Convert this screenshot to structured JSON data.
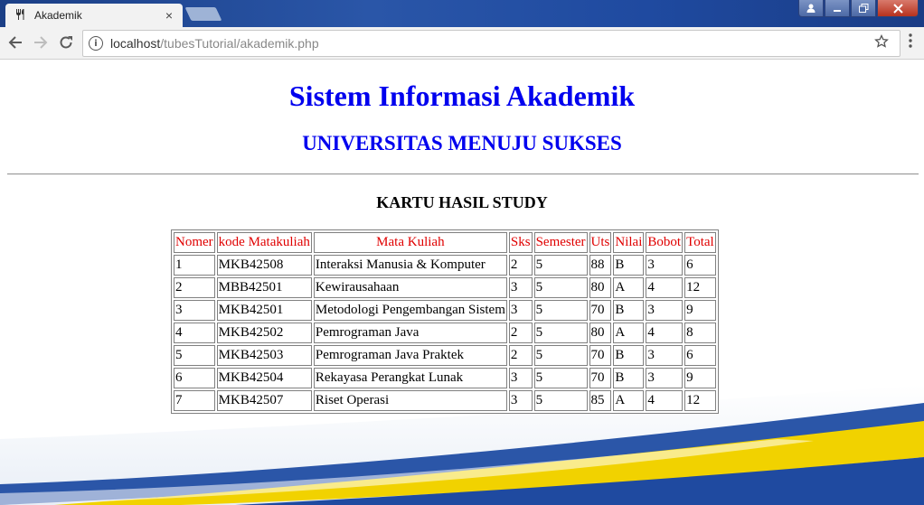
{
  "browser": {
    "tab_title": "Akademik",
    "tab_close": "×",
    "url_host": "localhost",
    "url_path": "/tubesTutorial/akademik.php",
    "icons": {
      "back": "arrow-left-icon",
      "forward": "arrow-right-icon",
      "reload": "reload-icon",
      "info": "info-icon",
      "bookmark": "star-icon",
      "menu": "kebab-menu-icon"
    }
  },
  "page": {
    "title": "Sistem Informasi Akademik",
    "university": "UNIVERSITAS MENUJU SUKSES",
    "section_title": "KARTU HASIL STUDY",
    "colors": {
      "heading": "#0000ee",
      "table_header": "#e00000"
    },
    "table": {
      "headers": [
        "Nomer",
        "kode Matakuliah",
        "Mata Kuliah",
        "Sks",
        "Semester",
        "Uts",
        "Nilai",
        "Bobot",
        "Total"
      ],
      "rows": [
        [
          "1",
          "MKB42508",
          "Interaksi Manusia & Komputer",
          "2",
          "5",
          "88",
          "B",
          "3",
          "6"
        ],
        [
          "2",
          "MBB42501",
          "Kewirausahaan",
          "3",
          "5",
          "80",
          "A",
          "4",
          "12"
        ],
        [
          "3",
          "MKB42501",
          "Metodologi Pengembangan Sistem",
          "3",
          "5",
          "70",
          "B",
          "3",
          "9"
        ],
        [
          "4",
          "MKB42502",
          "Pemrograman Java",
          "2",
          "5",
          "80",
          "A",
          "4",
          "8"
        ],
        [
          "5",
          "MKB42503",
          "Pemrograman Java Praktek",
          "2",
          "5",
          "70",
          "B",
          "3",
          "6"
        ],
        [
          "6",
          "MKB42504",
          "Rekayasa Perangkat Lunak",
          "3",
          "5",
          "70",
          "B",
          "3",
          "9"
        ],
        [
          "7",
          "MKB42507",
          "Riset Operasi",
          "3",
          "5",
          "85",
          "A",
          "4",
          "12"
        ]
      ]
    }
  }
}
